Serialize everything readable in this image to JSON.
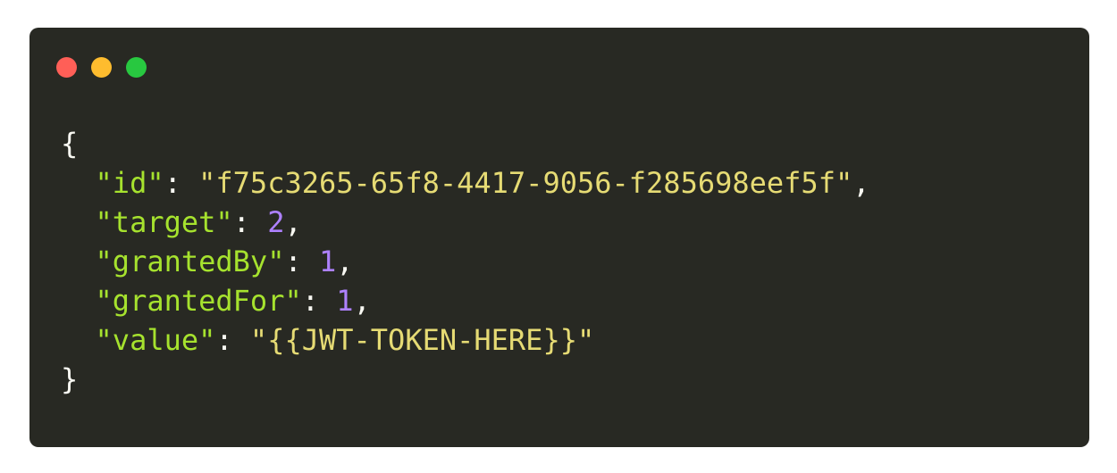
{
  "window": {
    "traffic_lights": [
      {
        "name": "close",
        "color": "#ff5f57"
      },
      {
        "name": "minimize",
        "color": "#febc2e"
      },
      {
        "name": "maximize",
        "color": "#28c840"
      }
    ]
  },
  "code": {
    "open_brace": "{",
    "close_brace": "}",
    "lines": [
      {
        "key": "\"id\"",
        "value": "\"f75c3265-65f8-4417-9056-f285698eef5f\"",
        "value_type": "string",
        "trailing": ","
      },
      {
        "key": "\"target\"",
        "value": "2",
        "value_type": "number",
        "trailing": ","
      },
      {
        "key": "\"grantedBy\"",
        "value": "1",
        "value_type": "number",
        "trailing": ","
      },
      {
        "key": "\"grantedFor\"",
        "value": "1",
        "value_type": "number",
        "trailing": ","
      },
      {
        "key": "\"value\"",
        "value": "\"{{JWT-TOKEN-HERE}}\"",
        "value_type": "string",
        "trailing": ""
      }
    ]
  },
  "colors": {
    "background": "#282923",
    "key": "#a6e22e",
    "string": "#e6db74",
    "number": "#ae81ff",
    "punctuation": "#f8f8f2"
  }
}
